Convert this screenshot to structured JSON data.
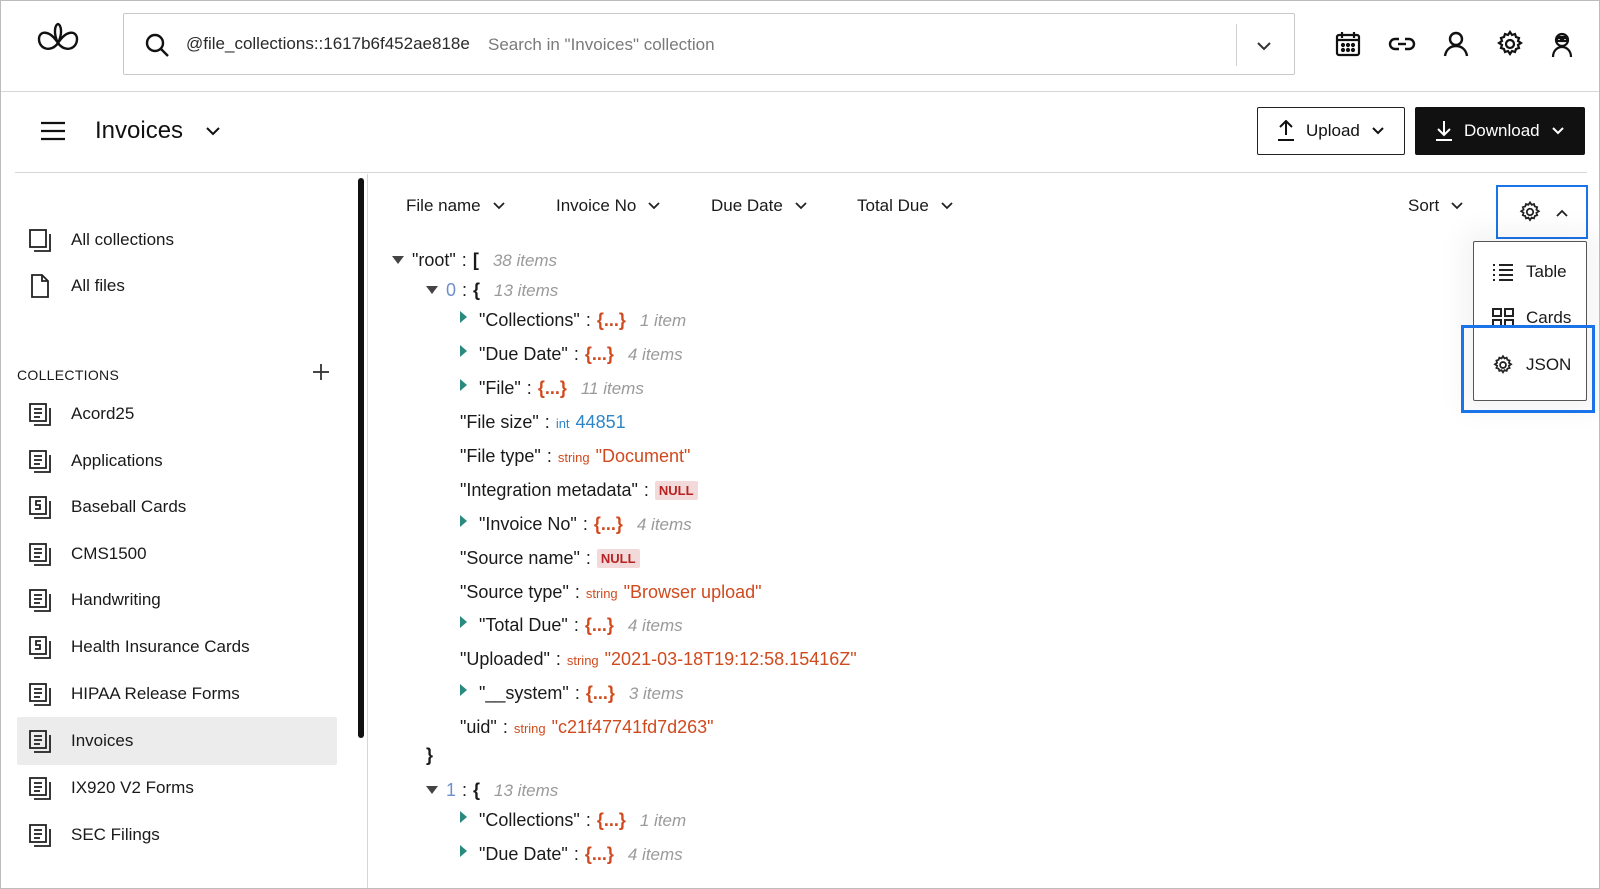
{
  "search": {
    "prefix": "@file_collections::1617b6f452ae818e",
    "placeholder": "Search in \"Invoices\" collection"
  },
  "header": {
    "title": "Invoices",
    "upload_label": "Upload",
    "download_label": "Download"
  },
  "sidebar": {
    "top_items": [
      {
        "label": "All collections",
        "icon": "collections-icon"
      },
      {
        "label": "All files",
        "icon": "file-icon"
      }
    ],
    "collections_heading": "COLLECTIONS",
    "collections": [
      {
        "label": "Acord25"
      },
      {
        "label": "Applications"
      },
      {
        "label": "Baseball Cards"
      },
      {
        "label": "CMS1500"
      },
      {
        "label": "Handwriting"
      },
      {
        "label": "Health Insurance Cards"
      },
      {
        "label": "HIPAA Release Forms"
      },
      {
        "label": "Invoices",
        "active": true
      },
      {
        "label": "IX920 V2 Forms"
      },
      {
        "label": "SEC Filings"
      }
    ]
  },
  "toolbar": {
    "filters": [
      "File name",
      "Invoice No",
      "Due Date",
      "Total Due"
    ],
    "sort_label": "Sort"
  },
  "view_menu": {
    "items": [
      {
        "label": "Table",
        "icon": "list-icon"
      },
      {
        "label": "Cards",
        "icon": "grid-icon"
      },
      {
        "label": "JSON",
        "icon": "gear-icon",
        "selected": true
      }
    ]
  },
  "tree": {
    "root_key": "\"root\"",
    "root_count": "38 items",
    "item0_index": "0",
    "item0_count": "13 items",
    "collections_key": "\"Collections\"",
    "collections_count": "1 item",
    "due_key": "\"Due Date\"",
    "due_count": "4 items",
    "file_key": "\"File\"",
    "file_count": "11 items",
    "size_key": "\"File size\"",
    "size_type": "int",
    "size_val": "44851",
    "ftype_key": "\"File type\"",
    "ftype_type": "string",
    "ftype_val": "\"Document\"",
    "integ_key": "\"Integration metadata\"",
    "null_label": "NULL",
    "invno_key": "\"Invoice No\"",
    "invno_count": "4 items",
    "srcname_key": "\"Source name\"",
    "srctype_key": "\"Source type\"",
    "srctype_type": "string",
    "srctype_val": "\"Browser upload\"",
    "total_key": "\"Total Due\"",
    "total_count": "4 items",
    "uploaded_key": "\"Uploaded\"",
    "uploaded_type": "string",
    "uploaded_val": "\"2021-03-18T19:12:58.15416Z\"",
    "system_key": "\"__system\"",
    "system_count": "3 items",
    "uid_key": "\"uid\"",
    "uid_type": "string",
    "uid_val": "\"c21f47741fd7d263\"",
    "item1_index": "1",
    "item1_count": "13 items",
    "open_brace": "{",
    "close_brace": "}",
    "open_bracket": "[",
    "collapsed": "{...}",
    "colon": ":"
  },
  "colors": {
    "accent": "#1a73e8",
    "string": "#d04a1e",
    "int": "#2e86c8",
    "null_bg": "#f3dada"
  }
}
